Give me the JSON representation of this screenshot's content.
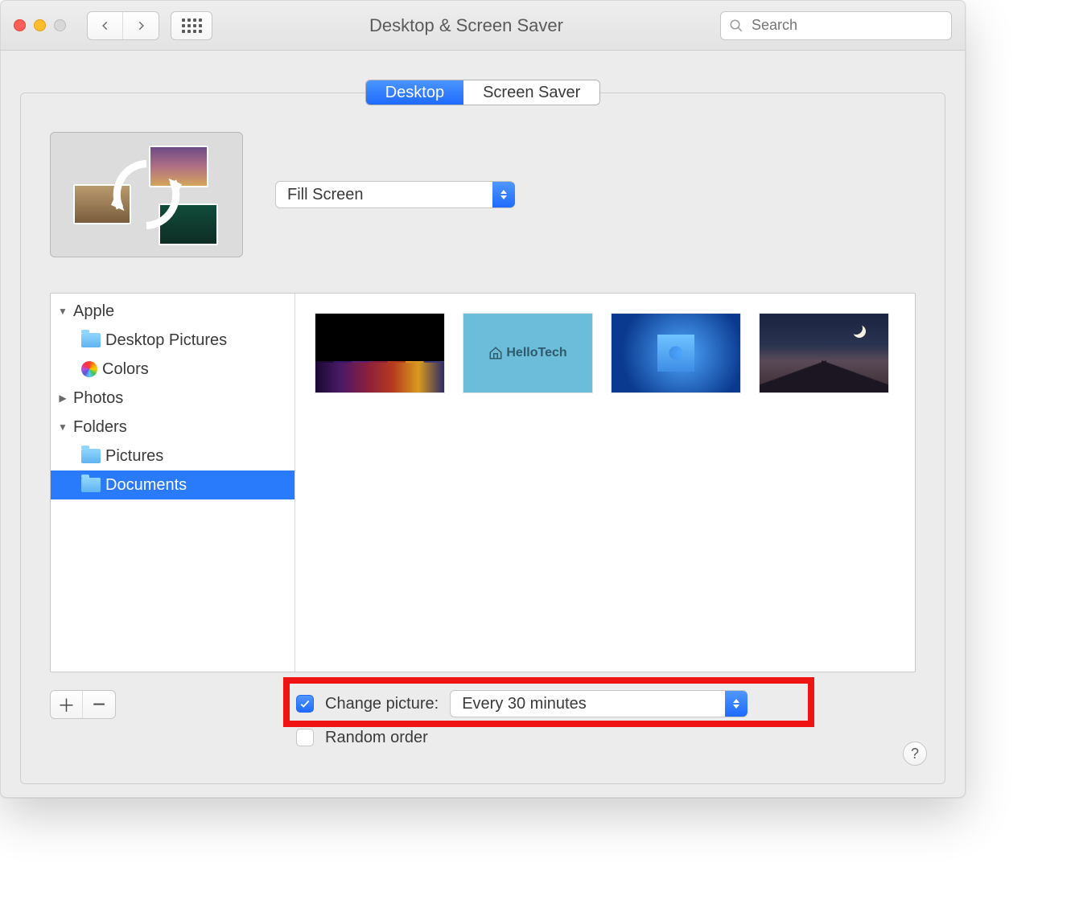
{
  "window": {
    "title": "Desktop & Screen Saver",
    "search_placeholder": "Search"
  },
  "tabs": {
    "desktop": "Desktop",
    "screensaver": "Screen Saver"
  },
  "fit_mode": {
    "selected": "Fill Screen"
  },
  "sidebar": {
    "apple": "Apple",
    "desktop_pictures": "Desktop Pictures",
    "colors": "Colors",
    "photos": "Photos",
    "folders": "Folders",
    "pictures": "Pictures",
    "documents": "Documents"
  },
  "thumb2_label": "HelloTech",
  "change_picture": {
    "label": "Change picture:",
    "checked": true,
    "interval_selected": "Every 30 minutes"
  },
  "random_order": {
    "label": "Random order",
    "checked": false
  },
  "help": "?"
}
